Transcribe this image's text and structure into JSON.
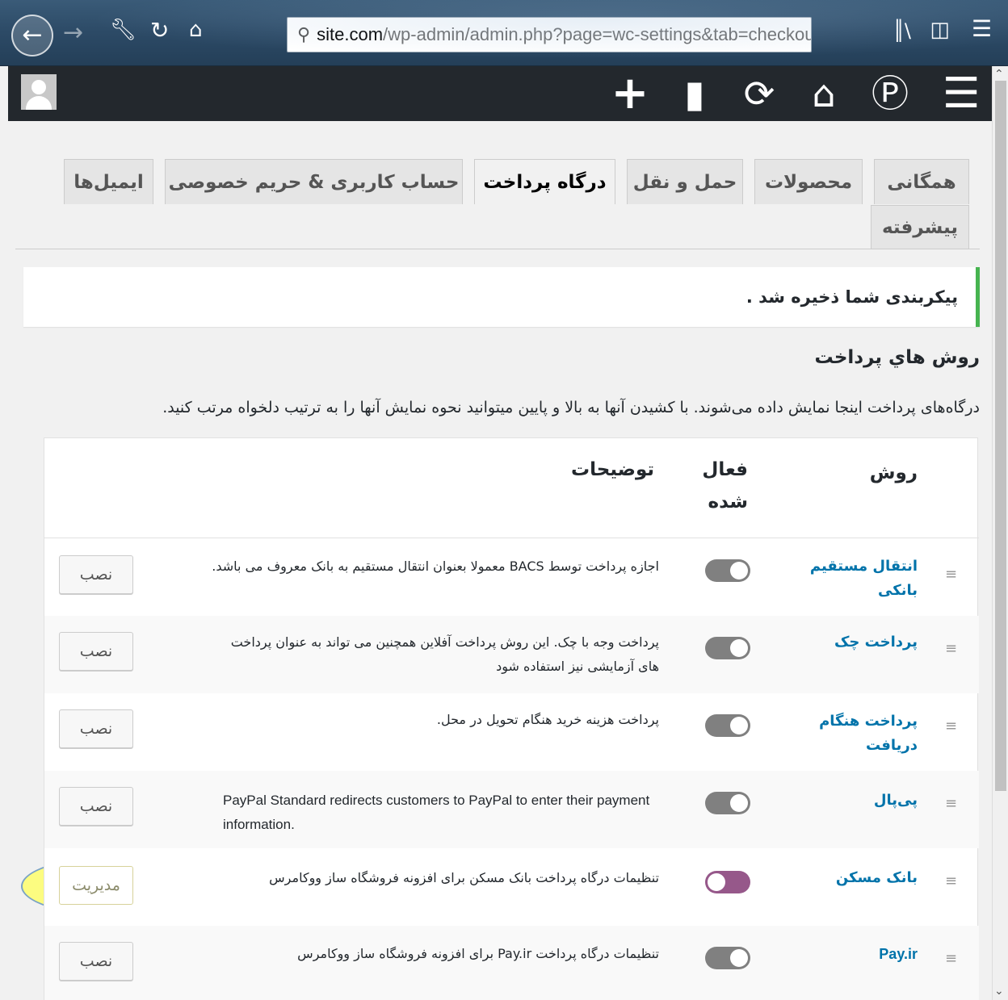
{
  "browser": {
    "url_host": "site.com",
    "url_rest": "/wp-admin/admin.php?page=wc-settings&tab=checkout",
    "icons": [
      "back-icon",
      "forward-icon",
      "wrench-icon",
      "reload-icon",
      "home-icon",
      "search-icon",
      "library-icon",
      "reader-icon",
      "menu-icon"
    ]
  },
  "admin_bar": {
    "icons": [
      "avatar",
      "plus-icon",
      "comment-icon",
      "updates-icon",
      "home-icon",
      "wordpress-icon",
      "menu-icon"
    ]
  },
  "tabs": [
    {
      "label": "همگانی"
    },
    {
      "label": "محصولات"
    },
    {
      "label": "حمل و نقل"
    },
    {
      "label": "درگاه پرداخت",
      "active": true
    },
    {
      "label": "حساب کاربری & حریم خصوصی"
    },
    {
      "label": "ایمیل‌ها"
    },
    {
      "label": "پیشرفته"
    }
  ],
  "notice": {
    "text": "پیکربندی شما ذخیره شد .",
    "color": "#46b450"
  },
  "section": {
    "title": "روش هاي پرداخت",
    "description": "درگاه‌های پرداخت اینجا نمایش داده می‌شوند. با کشیدن آنها به بالا و پایین میتوانید نحوه نمایش آنها را به ترتیب دلخواه مرتب کنید."
  },
  "table": {
    "headers": {
      "method": "روش",
      "enabled_line1": "فعال",
      "enabled_line2": "شده",
      "description": "توضیحات"
    },
    "rows": [
      {
        "name": "انتقال مستقیم بانکی",
        "enabled": false,
        "description": "اجازه پرداخت توسط BACS معمولا بعنوان انتقال مستقیم به بانک معروف می باشد.",
        "action": "نصب"
      },
      {
        "name": "پرداخت چک",
        "enabled": false,
        "description": "پرداخت وجه با چک. این روش پرداخت آفلاین همچنین می تواند به عنوان پرداخت های آزمایشی نیز استفاده شود",
        "action": "نصب"
      },
      {
        "name": "پرداخت هنگام دریافت",
        "enabled": false,
        "description": "پرداخت هزینه خرید هنگام تحویل در محل.",
        "action": "نصب"
      },
      {
        "name": "پی‌پال",
        "enabled": false,
        "description": "PayPal Standard redirects customers to PayPal to enter their payment information.",
        "action": "نصب"
      },
      {
        "name": "بانک مسکن",
        "enabled": true,
        "description": "تنظیمات درگاه پرداخت بانک مسکن برای افزونه فروشگاه ساز ووکامرس",
        "action": "مدیریت"
      },
      {
        "name": "Pay.ir",
        "enabled": false,
        "description": "تنظیمات درگاه پرداخت Pay.ir برای افزونه فروشگاه ساز ووکامرس",
        "action": "نصب"
      }
    ]
  },
  "colors": {
    "admin_bar": "#23282d",
    "link": "#0073aa",
    "toggle_on": "#96588a",
    "toggle_off": "#808080",
    "highlight": "#ffff5a"
  }
}
